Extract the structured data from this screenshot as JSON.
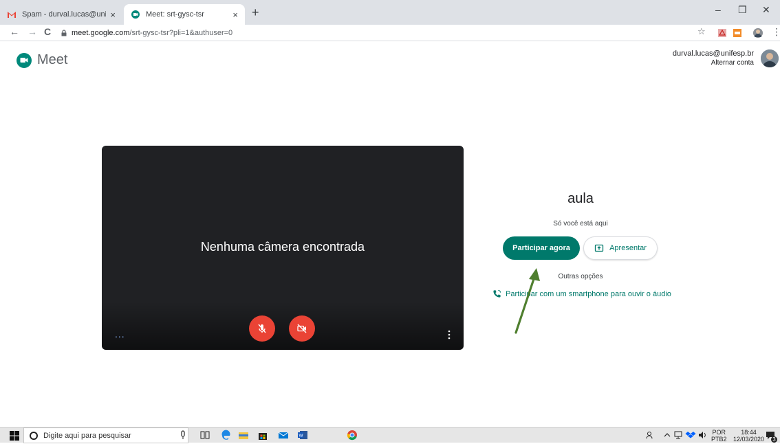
{
  "browser": {
    "tabs": [
      {
        "title": "Spam - durval.lucas@unifesp.br -",
        "active": false
      },
      {
        "title": "Meet: srt-gysc-tsr",
        "active": true
      }
    ],
    "new_tab": "+",
    "close_glyph": "×",
    "url_host": "meet.google.com",
    "url_path": "/srt-gysc-tsr?pli=1&authuser=0",
    "window": {
      "minimize": "–",
      "restore": "❐",
      "close": "✕"
    },
    "nav": {
      "back": "←",
      "forward": "→",
      "reload": "C"
    },
    "bookmark_star": "☆",
    "menu": "⋮"
  },
  "meet": {
    "product": "Meet",
    "account_email": "durval.lucas@unifesp.br",
    "switch_account": "Alternar conta",
    "preview": {
      "message": "Nenhuma câmera encontrada",
      "dots": "..."
    },
    "meeting_name": "aula",
    "status": "Só você está aqui",
    "join_label": "Participar agora",
    "present_label": "Apresentar",
    "other_options": "Outras opções",
    "phone_label": "Participar com um smartphone para ouvir o áudio"
  },
  "taskbar": {
    "search_placeholder": "Digite aqui para pesquisar",
    "lang_top": "POR",
    "lang_bottom": "PTB2",
    "time": "18:44",
    "date": "12/03/2020",
    "notification_count": "3"
  },
  "colors": {
    "meet_green": "#00796b",
    "mic_red": "#ea4335",
    "annotation_arrow": "#4f7f2f"
  }
}
